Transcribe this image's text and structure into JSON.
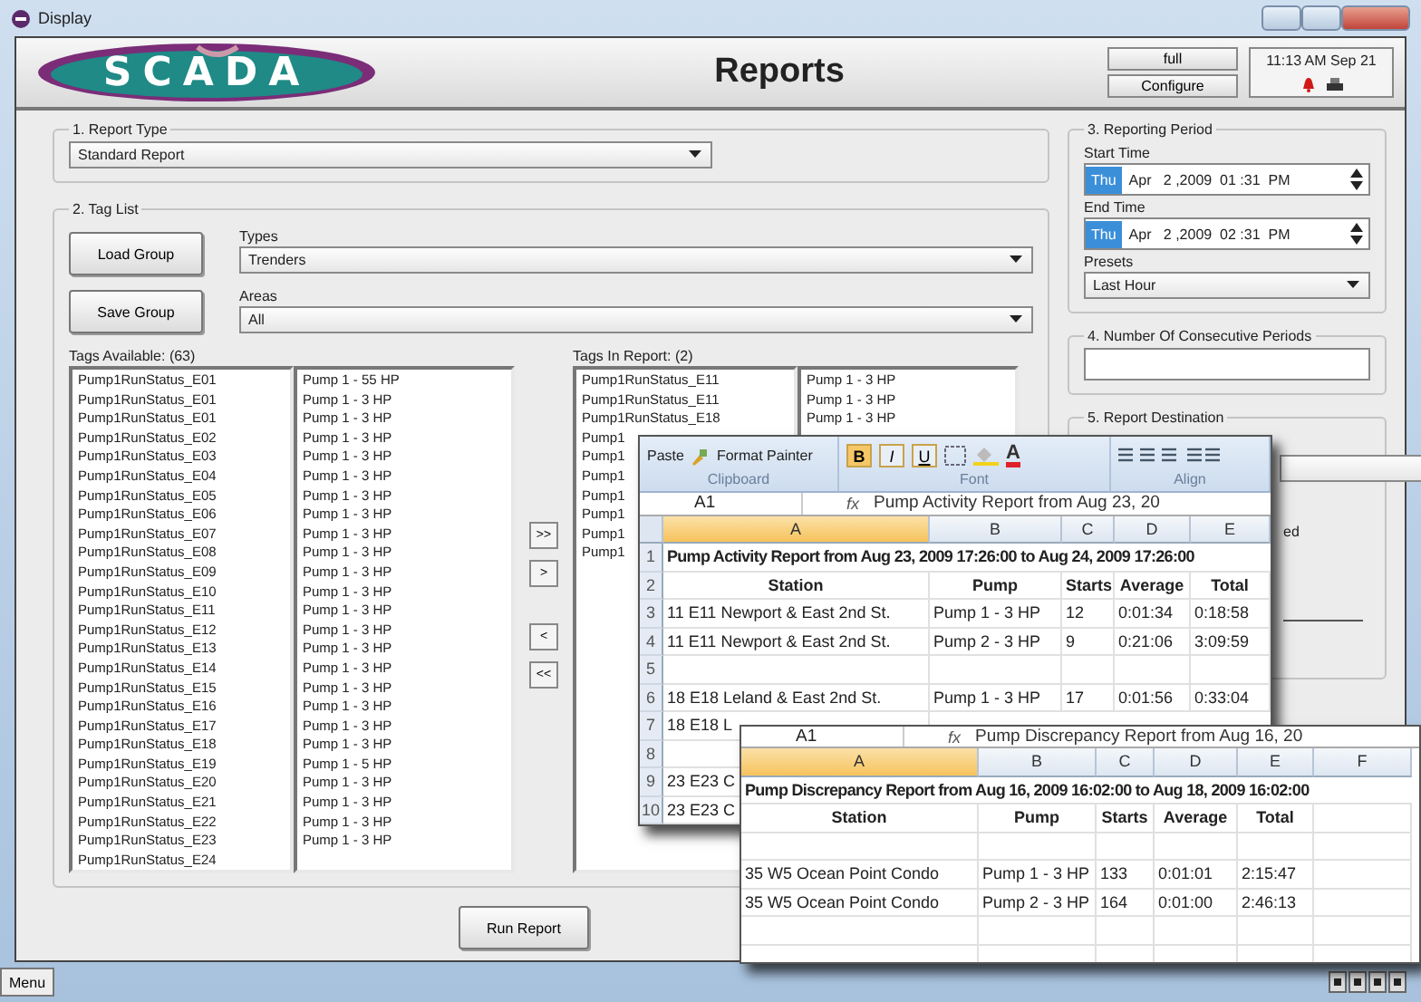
{
  "window": {
    "title": "Display"
  },
  "header": {
    "logo": "SCADA",
    "title": "Reports",
    "buttons": [
      "full",
      "Configure"
    ],
    "clock": "11:13 AM Sep 21"
  },
  "report_type": {
    "legend": "1. Report Type",
    "value": "Standard Report"
  },
  "tag_list": {
    "legend": "2. Tag List",
    "buttons": [
      "Load Group",
      "Save Group"
    ],
    "types": {
      "label": "Types",
      "value": "Trenders"
    },
    "areas": {
      "label": "Areas",
      "value": "All"
    },
    "available": {
      "label": "Tags Available: (63)",
      "tags": [
        "Pump1RunStatus_E01",
        "Pump1RunStatus_E01",
        "Pump1RunStatus_E01",
        "Pump1RunStatus_E02",
        "Pump1RunStatus_E03",
        "Pump1RunStatus_E04",
        "Pump1RunStatus_E05",
        "Pump1RunStatus_E06",
        "Pump1RunStatus_E07",
        "Pump1RunStatus_E08",
        "Pump1RunStatus_E09",
        "Pump1RunStatus_E10",
        "Pump1RunStatus_E11",
        "Pump1RunStatus_E12",
        "Pump1RunStatus_E13",
        "Pump1RunStatus_E14",
        "Pump1RunStatus_E15",
        "Pump1RunStatus_E16",
        "Pump1RunStatus_E17",
        "Pump1RunStatus_E18",
        "Pump1RunStatus_E19",
        "Pump1RunStatus_E20",
        "Pump1RunStatus_E21",
        "Pump1RunStatus_E22",
        "Pump1RunStatus_E23",
        "Pump1RunStatus_E24"
      ],
      "pumps": [
        "Pump 1 - 55 HP",
        "Pump 1 - 3 HP",
        "Pump 1 - 3 HP",
        "Pump 1 - 3 HP",
        "Pump 1 - 3 HP",
        "Pump 1 - 3 HP",
        "Pump 1 - 3 HP",
        "Pump 1 - 3 HP",
        "Pump 1 - 3 HP",
        "Pump 1 - 3 HP",
        "Pump 1 - 3 HP",
        "Pump 1 - 3 HP",
        "Pump 1 - 3 HP",
        "Pump 1 - 3 HP",
        "Pump 1 - 3 HP",
        "Pump 1 - 3 HP",
        "Pump 1 - 3 HP",
        "Pump 1 - 3 HP",
        "Pump 1 - 3 HP",
        "Pump 1 - 3 HP",
        "Pump 1 - 5 HP",
        "Pump 1 - 3 HP",
        "Pump 1 - 3 HP",
        "Pump 1 - 3 HP",
        "Pump 1 - 3 HP"
      ]
    },
    "move_buttons": [
      ">>",
      ">",
      "<",
      "<<"
    ],
    "in_report": {
      "label": "Tags In Report: (2)",
      "tags": [
        "Pump1RunStatus_E11",
        "Pump1RunStatus_E11",
        "Pump1RunStatus_E18",
        "Pump1",
        "Pump1",
        "Pump1",
        "Pump1",
        "Pump1",
        "Pump1",
        "Pump1"
      ],
      "pumps": [
        "Pump 1 - 3 HP",
        "Pump 1 - 3 HP",
        "Pump 1 - 3 HP"
      ]
    }
  },
  "run_button": "Run Report",
  "reporting_period": {
    "legend": "3. Reporting Period",
    "times": [
      {
        "label": "Start Time",
        "day": "Thu",
        "value": "Apr   2 ,2009  01 :31  PM"
      },
      {
        "label": "End Time",
        "day": "Thu",
        "value": "Apr   2 ,2009  02 :31  PM"
      }
    ],
    "presets": {
      "label": "Presets",
      "value": "Last Hour"
    }
  },
  "periods": {
    "legend": "4. Number Of Consecutive Periods"
  },
  "destination": {
    "legend": "5. Report Destination",
    "fragment": "ed"
  },
  "menu_button": "Menu",
  "spreadsheets": [
    {
      "ribbon": {
        "paste": "Paste",
        "format_painter": "Format Painter",
        "format_buttons": [
          "B",
          "I",
          "U"
        ],
        "font_color": "A",
        "groups": [
          "Clipboard",
          "Font",
          "Align"
        ]
      },
      "name_box": "A1",
      "fx": "fx",
      "formula": "Pump Activity Report from Aug 23, 20",
      "columns": [
        "A",
        "B",
        "C",
        "D",
        "E"
      ],
      "rows": [
        {
          "number": "1",
          "kind": "title",
          "cells": [
            "Pump Activity Report from Aug 23, 2009 17:26:00 to Aug 24, 2009 17:26:00"
          ]
        },
        {
          "number": "2",
          "kind": "header",
          "cells": [
            "Station",
            "Pump",
            "Starts",
            "Average",
            "Total"
          ]
        },
        {
          "number": "3",
          "kind": "data",
          "cells": [
            "11 E11 Newport & East 2nd St.",
            "Pump 1 - 3 HP",
            "12",
            "0:01:34",
            "0:18:58"
          ]
        },
        {
          "number": "4",
          "kind": "data",
          "cells": [
            "11 E11 Newport & East 2nd St.",
            "Pump 2 - 3 HP",
            "9",
            "0:21:06",
            "3:09:59"
          ]
        },
        {
          "number": "5",
          "kind": "data",
          "cells": []
        },
        {
          "number": "6",
          "kind": "data",
          "cells": [
            "18 E18 Leland & East 2nd St.",
            "Pump 1 - 3 HP",
            "17",
            "0:01:56",
            "0:33:04"
          ]
        },
        {
          "number": "7",
          "kind": "data",
          "cells": [
            "18 E18 L"
          ]
        },
        {
          "number": "8",
          "kind": "data",
          "cells": []
        },
        {
          "number": "9",
          "kind": "data",
          "cells": [
            "23 E23 C"
          ]
        },
        {
          "number": "10",
          "kind": "data",
          "cells": [
            "23 E23 C"
          ]
        }
      ]
    },
    {
      "name_box": "A1",
      "fx": "fx",
      "formula": "Pump Discrepancy Report from Aug 16, 20",
      "columns": [
        "A",
        "B",
        "C",
        "D",
        "E",
        "F"
      ],
      "rows": [
        {
          "kind": "title",
          "cells": [
            "Pump Discrepancy Report from Aug 16, 2009 16:02:00 to Aug 18, 2009 16:02:00"
          ]
        },
        {
          "kind": "header",
          "cells": [
            "Station",
            "Pump",
            "Starts",
            "Average",
            "Total"
          ]
        },
        {
          "kind": "data",
          "cells": []
        },
        {
          "kind": "data",
          "cells": [
            "35 W5 Ocean Point Condo",
            "Pump 1 - 3 HP",
            "133",
            "0:01:01",
            "2:15:47"
          ]
        },
        {
          "kind": "data",
          "cells": [
            "35 W5 Ocean Point Condo",
            "Pump 2 - 3 HP",
            "164",
            "0:01:00",
            "2:46:13"
          ]
        },
        {
          "kind": "data",
          "cells": []
        },
        {
          "kind": "data",
          "cells": []
        }
      ]
    }
  ]
}
